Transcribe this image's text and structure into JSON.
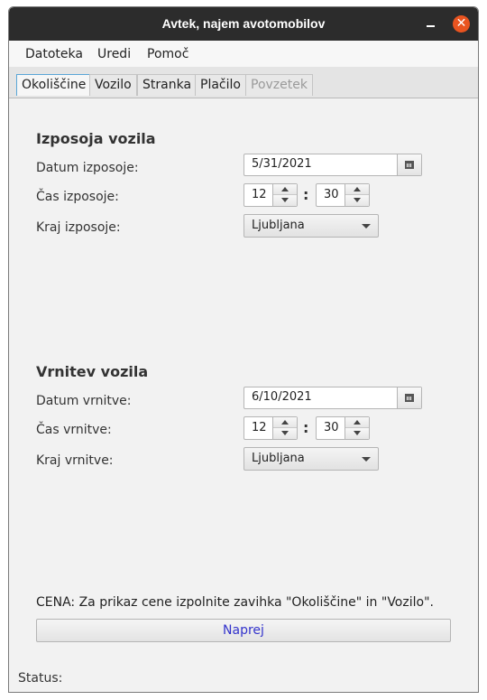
{
  "window": {
    "title": "Avtek, najem avotomobilov",
    "min_symbol": "",
    "close_symbol": "✕"
  },
  "menu": {
    "items": [
      "Datoteka",
      "Uredi",
      "Pomoč"
    ]
  },
  "tabs": [
    {
      "label": "Okoliščine",
      "state": "active"
    },
    {
      "label": "Vozilo",
      "state": "normal"
    },
    {
      "label": "Stranka",
      "state": "normal"
    },
    {
      "label": "Plačilo",
      "state": "normal"
    },
    {
      "label": "Povzetek",
      "state": "disabled"
    }
  ],
  "rental": {
    "title": "Izposoja vozila",
    "date_label": "Datum izposoje:",
    "date_value": "5/31/2021",
    "time_label": "Čas izposoje:",
    "hour": "12",
    "minute": "30",
    "place_label": "Kraj izposoje:",
    "place_value": "Ljubljana"
  },
  "return": {
    "title": "Vrnitev vozila",
    "date_label": "Datum vrnitve:",
    "date_value": "6/10/2021",
    "time_label": "Čas vrnitve:",
    "hour": "12",
    "minute": "30",
    "place_label": "Kraj vrnitve:",
    "place_value": "Ljubljana"
  },
  "colon": ":",
  "price_text": "CENA: Za prikaz cene izpolnite zavihka \"Okoliščine\" in \"Vozilo\".",
  "next_label": "Naprej",
  "status_label": "Status:",
  "colors": {
    "titlebar": "#2c2c2c",
    "close_button": "#e95420",
    "active_tab_border": "#5aa6d6",
    "next_button_text": "#3333cc"
  }
}
